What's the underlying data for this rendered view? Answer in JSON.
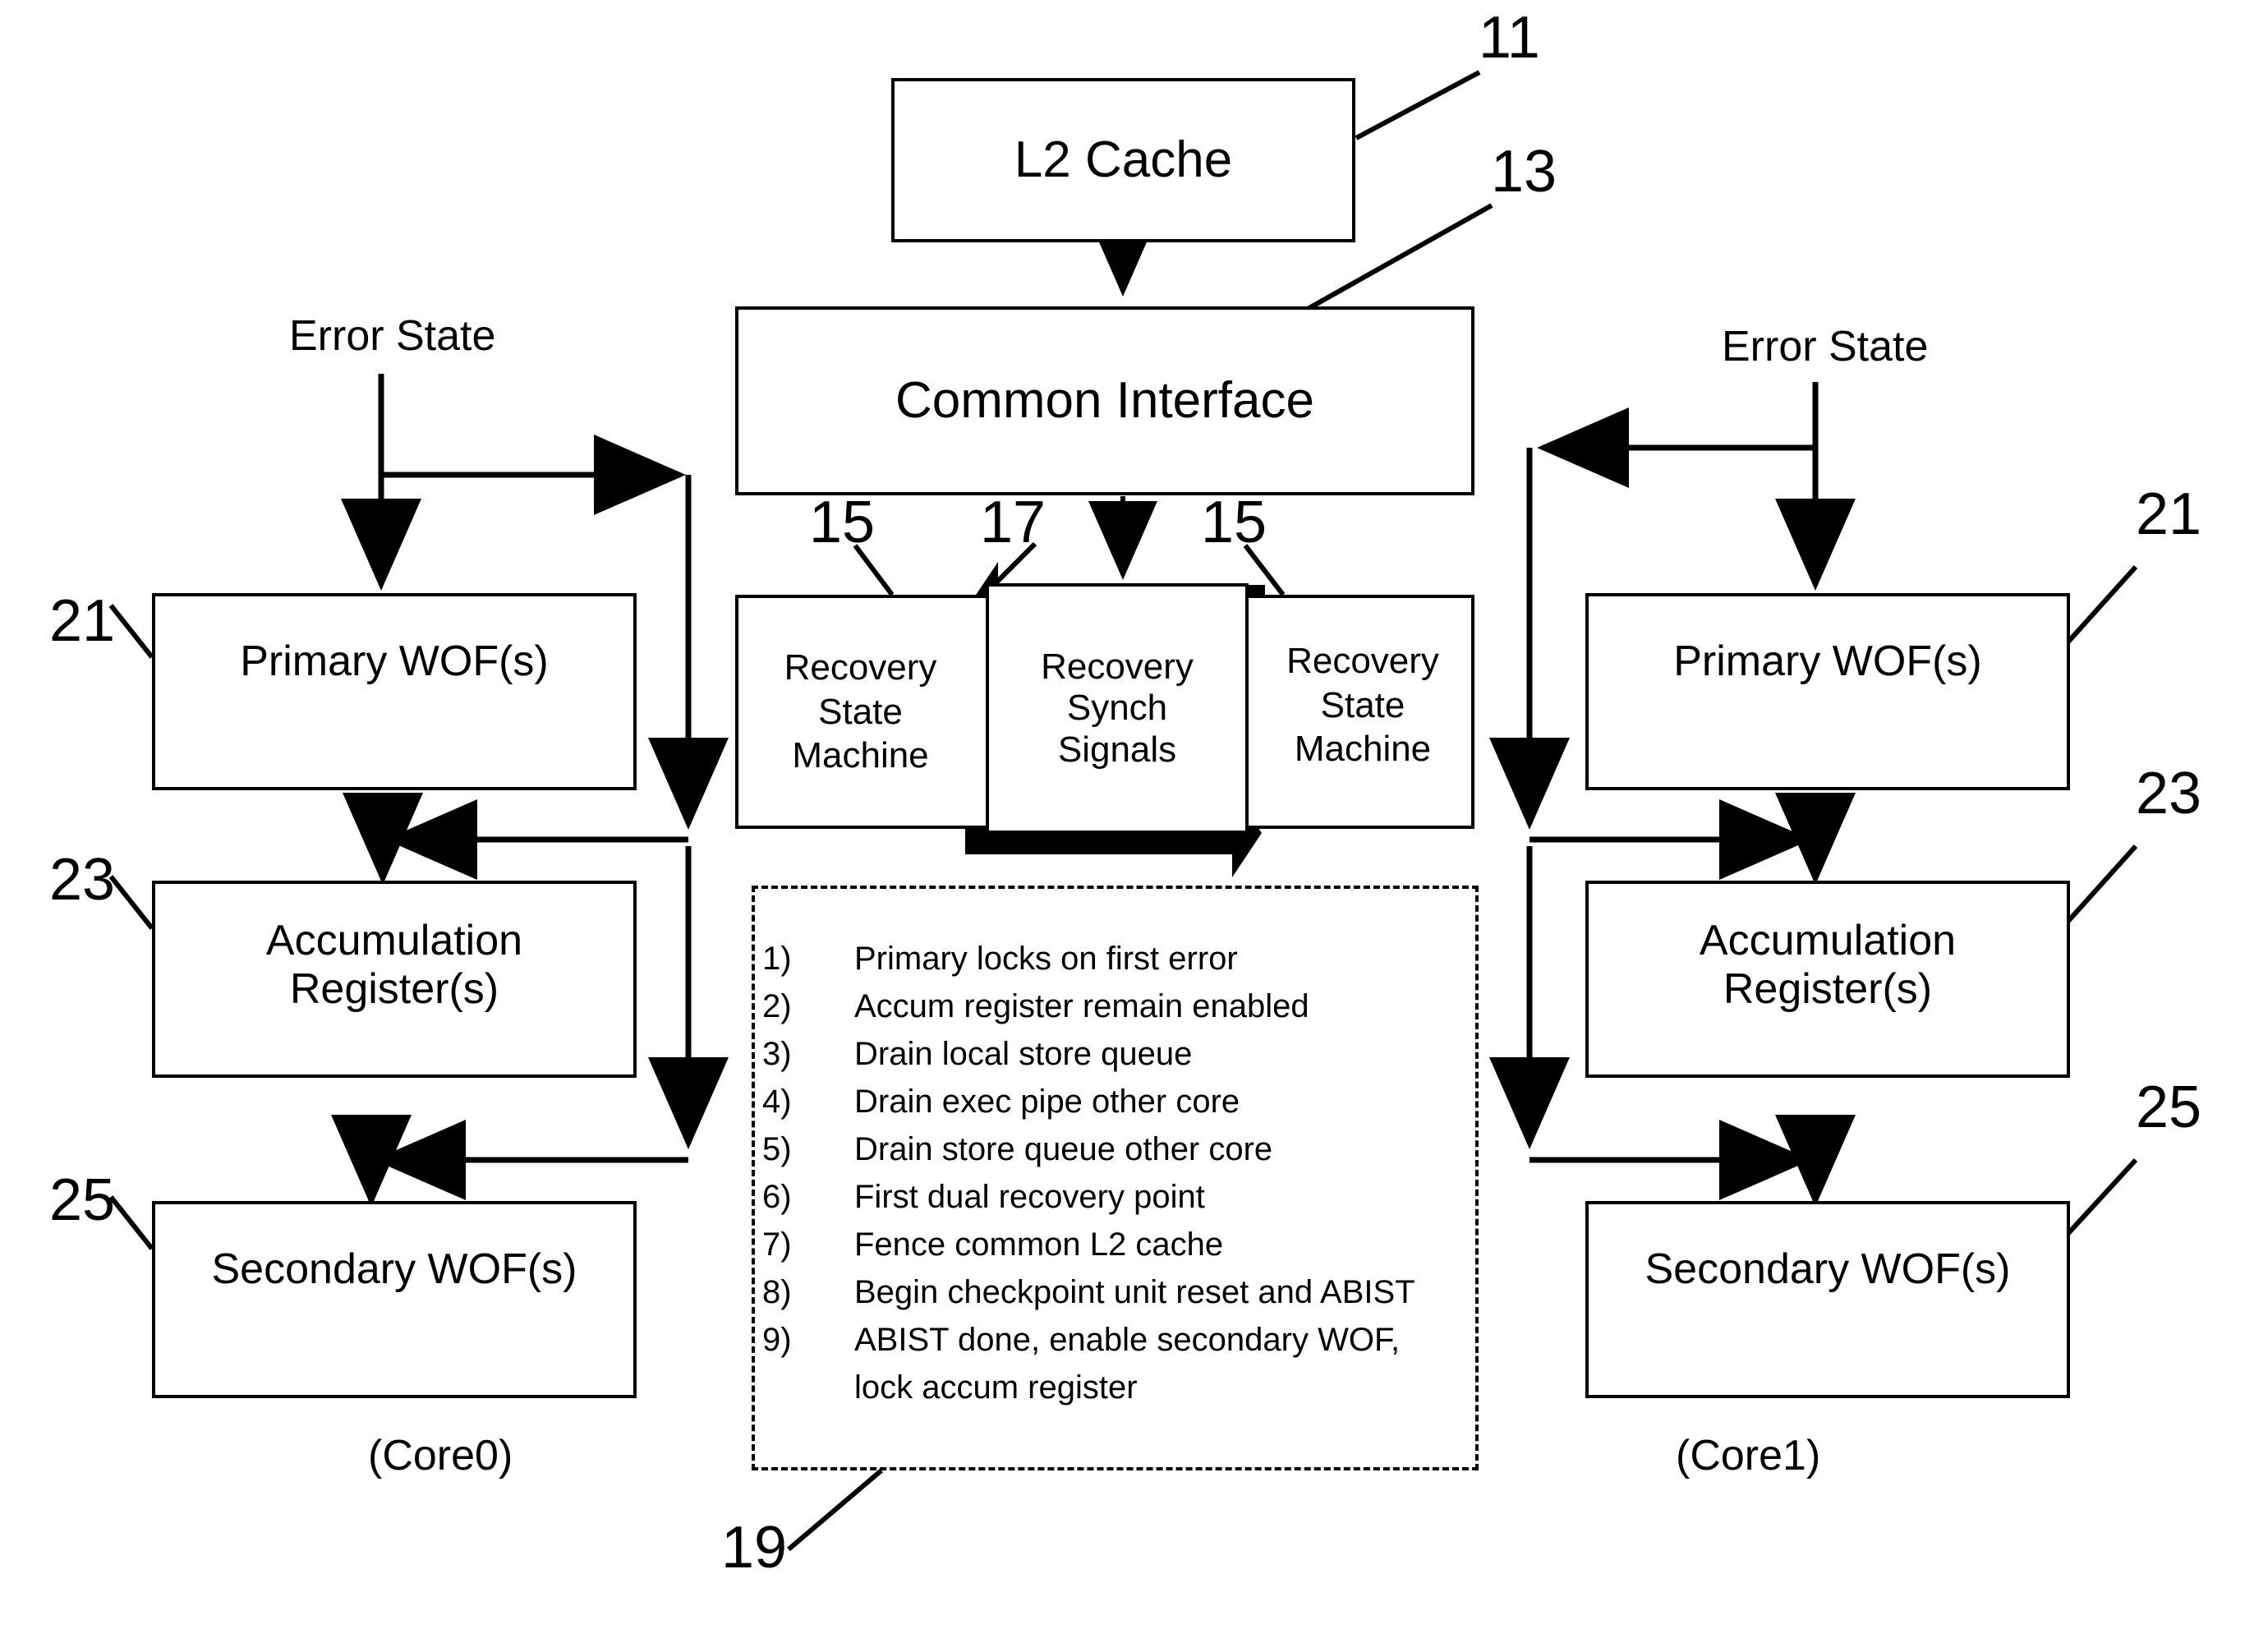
{
  "figure": {
    "top_block": {
      "label": "L2 Cache",
      "callout": "11"
    },
    "interface_block": {
      "label": "Common Interface",
      "callout": "13"
    },
    "center": {
      "left_state_machine": {
        "label": "Recovery\nState\nMachine",
        "callout": "15"
      },
      "right_state_machine": {
        "label": "Recovery\nState\nMachine",
        "callout": "15"
      },
      "synch_block": {
        "label": "Recovery\nSynch\nSignals",
        "callout": "17"
      }
    },
    "steps_box": {
      "callout": "19",
      "items": [
        {
          "num": "1)",
          "text": "Primary locks on first error"
        },
        {
          "num": "2)",
          "text": "Accum register remain enabled"
        },
        {
          "num": "3)",
          "text": "Drain local store queue"
        },
        {
          "num": "4)",
          "text": "Drain exec pipe other core"
        },
        {
          "num": "5)",
          "text": "Drain store queue other core"
        },
        {
          "num": "6)",
          "text": "First dual recovery point"
        },
        {
          "num": "7)",
          "text": "Fence common L2 cache"
        },
        {
          "num": "8)",
          "text": "Begin checkpoint unit reset and ABIST"
        },
        {
          "num": "9)",
          "text": "ABIST done, enable secondary WOF,",
          "cont": "lock accum register"
        }
      ]
    },
    "core0": {
      "footer": "(Core0)",
      "error_state_label": "Error State",
      "primary_wof": {
        "label": "Primary WOF(s)",
        "callout": "21"
      },
      "accumulation_register": {
        "label": "Accumulation\nRegister(s)",
        "callout": "23"
      },
      "secondary_wof": {
        "label": "Secondary WOF(s)",
        "callout": "25"
      }
    },
    "core1": {
      "footer": "(Core1)",
      "error_state_label": "Error State",
      "primary_wof": {
        "label": "Primary WOF(s)",
        "callout": "21"
      },
      "accumulation_register": {
        "label": "Accumulation\nRegister(s)",
        "callout": "23"
      },
      "secondary_wof": {
        "label": "Secondary WOF(s)",
        "callout": "25"
      }
    },
    "colors": {
      "stroke": "#000000",
      "background": "#ffffff"
    }
  }
}
